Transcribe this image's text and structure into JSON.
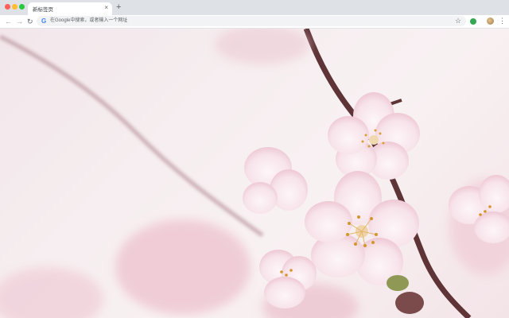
{
  "window": {
    "tab": {
      "title": "新标签页",
      "close_icon": "×"
    },
    "new_tab_label": "+"
  },
  "toolbar": {
    "back_icon": "←",
    "forward_icon": "→",
    "reload_icon": "↻",
    "omnibox": {
      "engine_icon": "G",
      "placeholder": "在Google中搜索，或者输入一个网址"
    },
    "bookmark_icon": "☆",
    "menu_icon": "⋮"
  },
  "content": {
    "background": "cherry-blossom-photo"
  },
  "colors": {
    "tabstrip": "#dee1e6",
    "omnibox": "#f1f3f4",
    "blossom": "#f7dde5",
    "branch": "#6b3b3b"
  }
}
